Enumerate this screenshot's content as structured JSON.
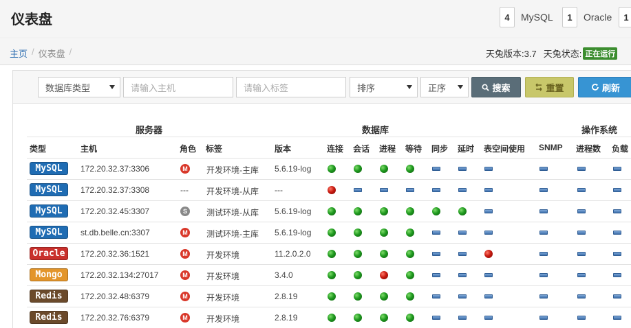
{
  "header": {
    "title": "仪表盘",
    "counters": [
      {
        "count": "4",
        "label": "MySQL"
      },
      {
        "count": "1",
        "label": "Oracle"
      },
      {
        "count": "1",
        "label": ""
      }
    ]
  },
  "breadcrumb": {
    "home": "主页",
    "current": "仪表盘",
    "sep": "/"
  },
  "version": {
    "text": "天兔版本:3.7",
    "status_label": "天兔状态:",
    "status_badge": "正在运行"
  },
  "filters": {
    "db_type": "数据库类型",
    "host_placeholder": "请输入主机",
    "tag_placeholder": "请输入标签",
    "sort": "排序",
    "order": "正序",
    "search_label": "搜索",
    "reset_label": "重置",
    "refresh_label": "刷新"
  },
  "table": {
    "groups": {
      "server": "服务器",
      "database": "数据库",
      "os": "操作系统"
    },
    "columns": {
      "type": "类型",
      "host": "主机",
      "role": "角色",
      "tag": "标签",
      "version": "版本",
      "connect": "连接",
      "session": "会话",
      "process": "进程",
      "wait": "等待",
      "sync": "同步",
      "delay": "延时",
      "tablespace": "表空间使用",
      "snmp": "SNMP",
      "proc_count": "进程数",
      "load": "负载"
    },
    "rows": [
      {
        "type": "MySQL",
        "host": "172.20.32.37:3306",
        "role": "M",
        "tag": "开发环境-主库",
        "version": "5.6.19-log",
        "status": [
          "ok",
          "ok",
          "ok",
          "ok",
          "none",
          "none",
          "none",
          "none",
          "none",
          "none"
        ]
      },
      {
        "type": "MySQL",
        "host": "172.20.32.37:3308",
        "role": "---",
        "tag": "开发环境-从库",
        "version": "---",
        "status": [
          "bad",
          "none",
          "none",
          "none",
          "none",
          "none",
          "none",
          "none",
          "none",
          "none"
        ]
      },
      {
        "type": "MySQL",
        "host": "172.20.32.45:3307",
        "role": "S",
        "tag": "测试环境-从库",
        "version": "5.6.19-log",
        "status": [
          "ok",
          "ok",
          "ok",
          "ok",
          "ok",
          "ok",
          "none",
          "none",
          "none",
          "none"
        ]
      },
      {
        "type": "MySQL",
        "host": "st.db.belle.cn:3307",
        "role": "M",
        "tag": "测试环境-主库",
        "version": "5.6.19-log",
        "status": [
          "ok",
          "ok",
          "ok",
          "ok",
          "none",
          "none",
          "none",
          "none",
          "none",
          "none"
        ]
      },
      {
        "type": "Oracle",
        "host": "172.20.32.36:1521",
        "role": "M",
        "tag": "开发环境",
        "version": "11.2.0.2.0",
        "status": [
          "ok",
          "ok",
          "ok",
          "ok",
          "none",
          "none",
          "bad",
          "none",
          "none",
          "none"
        ]
      },
      {
        "type": "Mongo",
        "host": "172.20.32.134:27017",
        "role": "M",
        "tag": "开发环境",
        "version": "3.4.0",
        "status": [
          "ok",
          "ok",
          "bad",
          "ok",
          "none",
          "none",
          "none",
          "none",
          "none",
          "none"
        ]
      },
      {
        "type": "Redis",
        "host": "172.20.32.48:6379",
        "role": "M",
        "tag": "开发环境",
        "version": "2.8.19",
        "status": [
          "ok",
          "ok",
          "ok",
          "ok",
          "none",
          "none",
          "none",
          "none",
          "none",
          "none"
        ]
      },
      {
        "type": "Redis",
        "host": "172.20.32.76:6379",
        "role": "M",
        "tag": "开发环境",
        "version": "2.8.19",
        "status": [
          "ok",
          "ok",
          "ok",
          "ok",
          "none",
          "none",
          "none",
          "none",
          "none",
          "none"
        ]
      }
    ]
  },
  "colors": {
    "MySQL": "#1f6cb3",
    "Oracle": "#c9302c",
    "Mongo": "#e3952a",
    "Redis": "#6b4a2b"
  }
}
